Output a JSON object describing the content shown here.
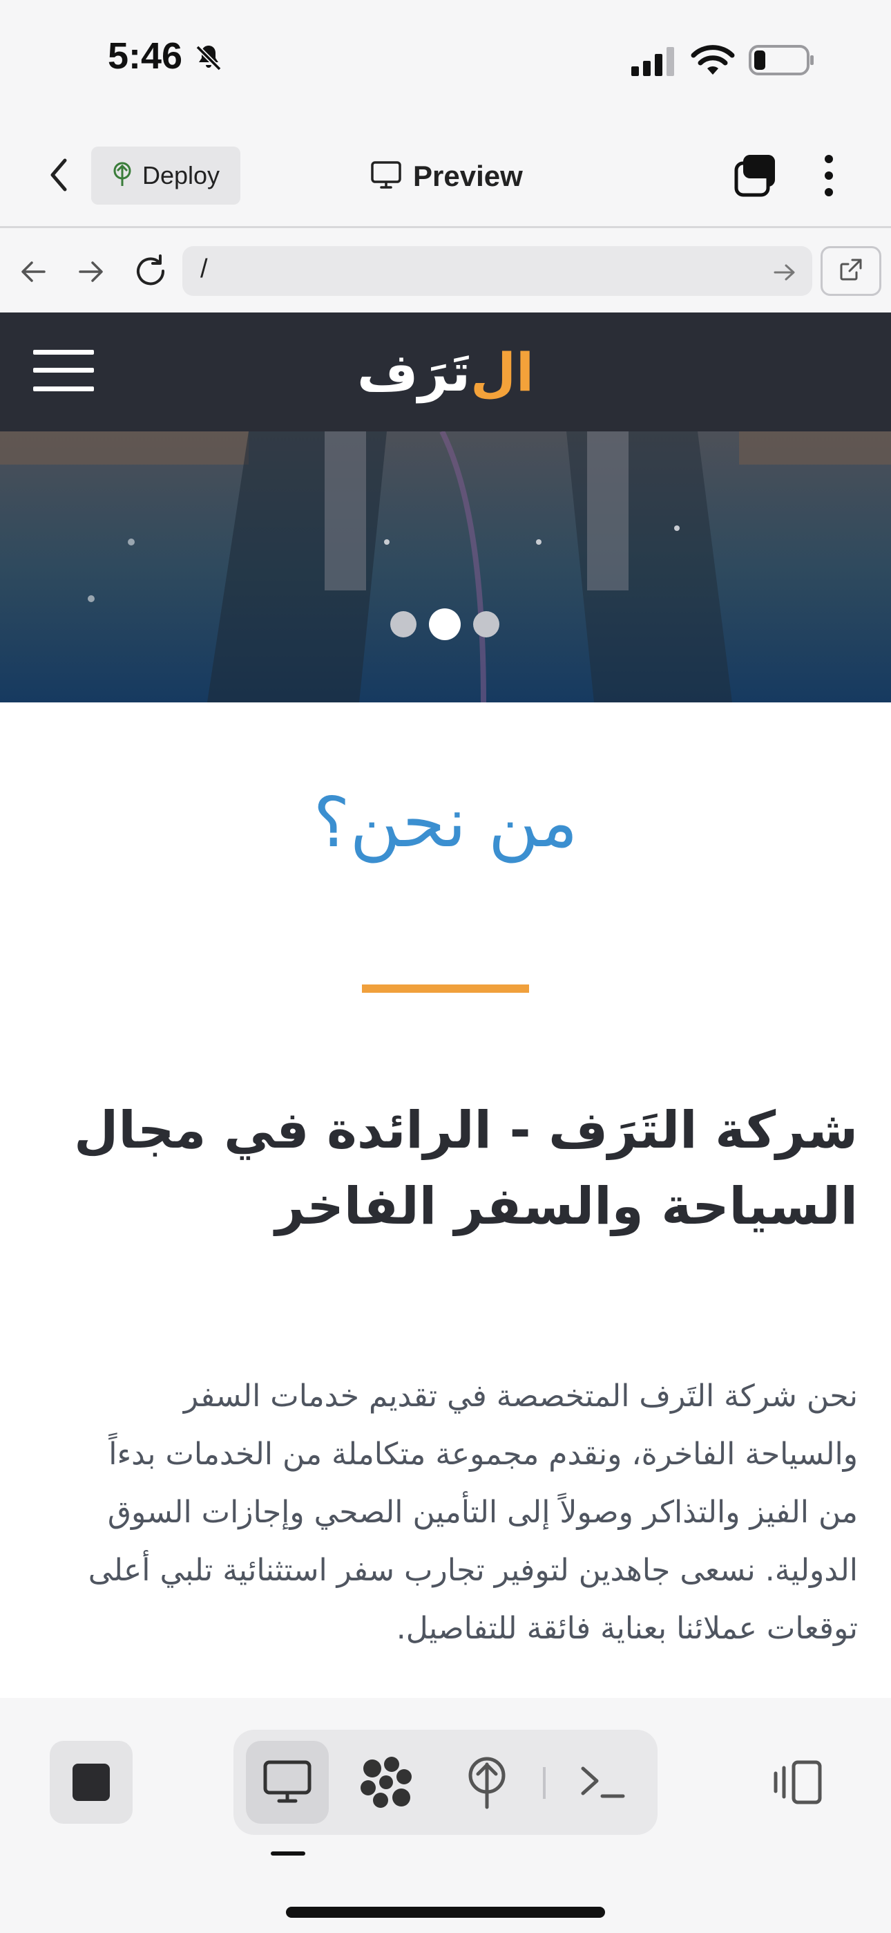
{
  "status_bar": {
    "time": "5:46"
  },
  "app_header": {
    "deploy_label": "Deploy",
    "preview_label": "Preview"
  },
  "browser": {
    "url": "/"
  },
  "site": {
    "logo_prefix": "ال",
    "logo_main": "تَرَف",
    "hero_dots": {
      "count": 3,
      "active_index": 1
    },
    "about_title": "من نحن؟",
    "heading": "شركة التَرَف - الرائدة في مجال السياحة والسفر الفاخر",
    "paragraph": "نحن شركة التَرف المتخصصة في تقديم خدمات السفر والسياحة الفاخرة، ونقدم مجموعة متكاملة من الخدمات بدءاً من الفيز والتذاكر وصولاً إلى التأمين الصحي وإجازات السوق الدولية. نسعى جاهدين لتوفير تجارب سفر استثنائية تلبي أعلى توقعات عملائنا بعناية فائقة للتفاصيل."
  },
  "colors": {
    "nav_bg": "#2a2d36",
    "accent_orange": "#f0a03c",
    "accent_blue": "#3b8fd0",
    "heading_text": "#2b2d33"
  },
  "bottom_toolbar": {
    "icons": [
      "stop-icon",
      "desktop-icon",
      "workspace-icon",
      "deploy-icon",
      "terminal-icon",
      "device-rotate-icon"
    ]
  }
}
